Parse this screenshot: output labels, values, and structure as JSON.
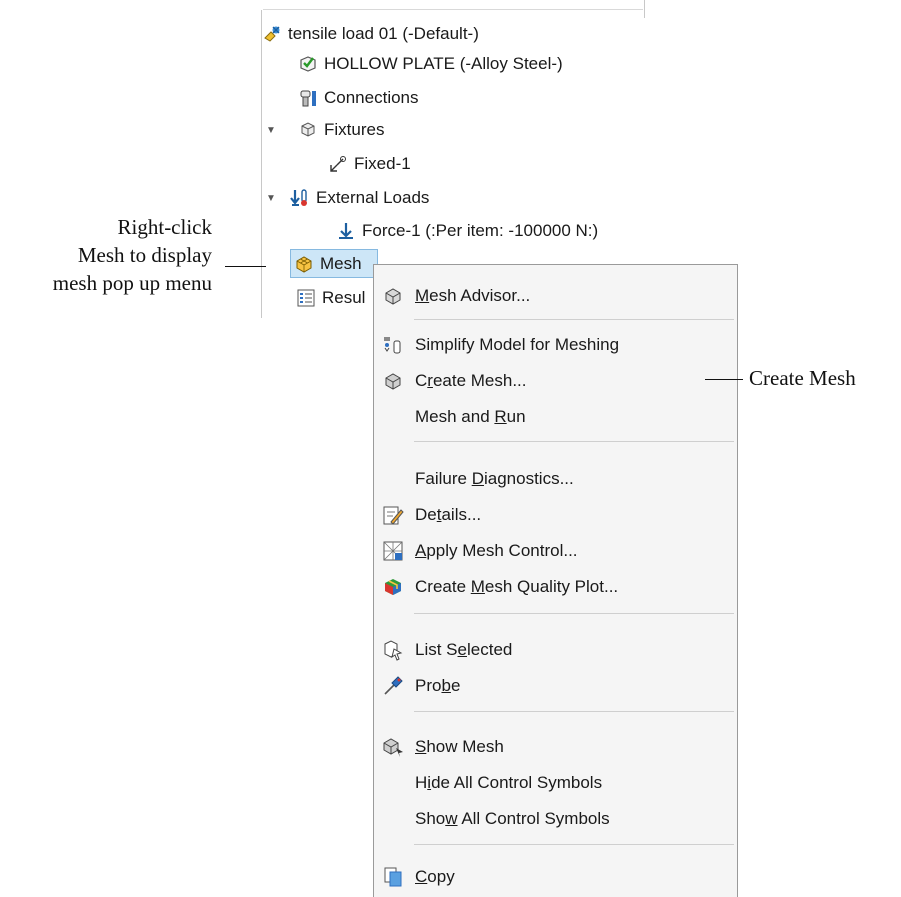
{
  "tree": {
    "root": "tensile load 01 (-Default-)",
    "part": "HOLLOW PLATE (-Alloy Steel-)",
    "connections": "Connections",
    "fixtures": "Fixtures",
    "fixed": "Fixed-1",
    "external_loads": "External Loads",
    "force": "Force-1 (:Per item: -100000 N:)",
    "mesh": "Mesh",
    "results": "Resul"
  },
  "menu": {
    "items": [
      {
        "pre": "",
        "u": "M",
        "post": "esh Advisor..."
      },
      {
        "pre": "Simplify Model for Meshing",
        "u": "",
        "post": ""
      },
      {
        "pre": "C",
        "u": "r",
        "post": "eate Mesh..."
      },
      {
        "pre": "Mesh and ",
        "u": "R",
        "post": "un"
      },
      {
        "pre": "Failure ",
        "u": "D",
        "post": "iagnostics..."
      },
      {
        "pre": "De",
        "u": "t",
        "post": "ails..."
      },
      {
        "pre": "",
        "u": "A",
        "post": "pply Mesh Control..."
      },
      {
        "pre": "Create ",
        "u": "M",
        "post": "esh Quality Plot..."
      },
      {
        "pre": "List S",
        "u": "e",
        "post": "lected"
      },
      {
        "pre": "Pro",
        "u": "b",
        "post": "e"
      },
      {
        "pre": "",
        "u": "S",
        "post": "how Mesh"
      },
      {
        "pre": "H",
        "u": "i",
        "post": "de All Control Symbols"
      },
      {
        "pre": "Sho",
        "u": "w",
        "post": " All Control Symbols"
      },
      {
        "pre": "",
        "u": "C",
        "post": "opy"
      }
    ]
  },
  "callouts": {
    "right_click_line1": "Right-click",
    "right_click_line2": "Mesh to display",
    "right_click_line3": "mesh pop up menu",
    "create_mesh": "Create Mesh"
  }
}
